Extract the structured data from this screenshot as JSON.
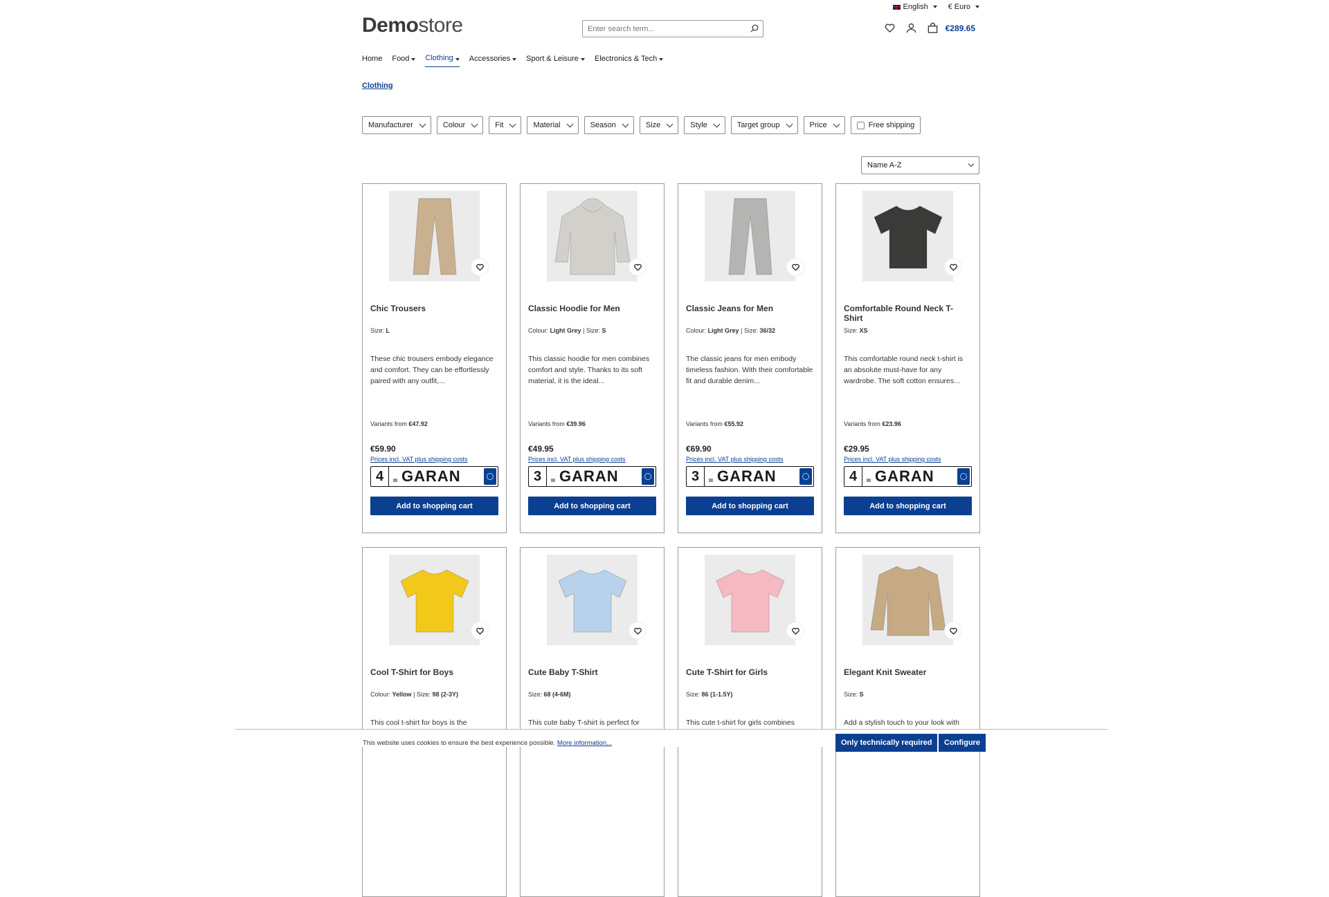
{
  "topbar": {
    "language": "English",
    "currency": "€ Euro"
  },
  "header": {
    "logo_bold": "Demo",
    "logo_light": "store",
    "search_placeholder": "Enter search term...",
    "cart_total": "€289.65"
  },
  "nav": [
    {
      "label": "Home",
      "dropdown": false
    },
    {
      "label": "Food",
      "dropdown": true
    },
    {
      "label": "Clothing",
      "dropdown": true,
      "active": true
    },
    {
      "label": "Accessories",
      "dropdown": true
    },
    {
      "label": "Sport & Leisure",
      "dropdown": true
    },
    {
      "label": "Electronics & Tech",
      "dropdown": true
    }
  ],
  "breadcrumb": "Clothing",
  "filters": [
    "Manufacturer",
    "Colour",
    "Fit",
    "Material",
    "Season",
    "Size",
    "Style",
    "Target group",
    "Price"
  ],
  "free_shipping": "Free shipping",
  "sort": "Name A-Z",
  "common": {
    "vat": "Prices incl. VAT plus shipping costs",
    "add_to_cart": "Add to shopping cart",
    "variants_from": "Variants from",
    "garant_word": "GARAN"
  },
  "products": [
    {
      "name": "Chic Trousers",
      "props": [
        {
          "k": "Size:",
          "v": "L"
        }
      ],
      "desc": "These chic trousers embody elegance and comfort. They can be effortlessly paired with any outfit,...",
      "variants": "€47.92",
      "price": "€59.90",
      "garant": "4",
      "garment": "trousers",
      "color": "#c9b08e"
    },
    {
      "name": "Classic Hoodie for Men",
      "props": [
        {
          "k": "Colour:",
          "v": "Light Grey"
        },
        {
          "k": "Size:",
          "v": "S"
        }
      ],
      "desc": "This classic hoodie for men combines comfort and style. Thanks to its soft material, it is the ideal...",
      "variants": "€39.96",
      "price": "€49.95",
      "garant": "3",
      "garment": "hoodie",
      "color": "#d2d0cb"
    },
    {
      "name": "Classic Jeans for Men",
      "props": [
        {
          "k": "Colour:",
          "v": "Light Grey"
        },
        {
          "k": "Size:",
          "v": "36/32"
        }
      ],
      "desc": "The classic jeans for men embody timeless fashion. With their comfortable fit and durable denim...",
      "variants": "€55.92",
      "price": "€69.90",
      "garant": "3",
      "garment": "trousers",
      "color": "#b4b4b2"
    },
    {
      "name": "Comfortable Round Neck T-Shirt",
      "props": [
        {
          "k": "Size:",
          "v": "XS"
        }
      ],
      "desc": "This comfortable round neck t-shirt is an absolute must-have for any wardrobe. The soft cotton ensures...",
      "variants": "€23.96",
      "price": "€29.95",
      "garant": "4",
      "garment": "tshirt",
      "color": "#3a3b38"
    },
    {
      "name": "Cool T-Shirt for Boys",
      "props": [
        {
          "k": "Colour:",
          "v": "Yellow"
        },
        {
          "k": "Size:",
          "v": "98 (2-3Y)"
        }
      ],
      "desc": "This cool t-shirt for boys is the",
      "garment": "tshirt",
      "color": "#f2c81a"
    },
    {
      "name": "Cute Baby T-Shirt",
      "props": [
        {
          "k": "Size:",
          "v": "68 (4-6M)"
        }
      ],
      "desc": "This cute baby T-shirt is perfect for",
      "garment": "tshirt",
      "color": "#b7d2ea"
    },
    {
      "name": "Cute T-Shirt for Girls",
      "props": [
        {
          "k": "Size:",
          "v": "86 (1-1.5Y)"
        }
      ],
      "desc": "This cute t-shirt for girls combines",
      "garment": "tshirt",
      "color": "#f4b9c1"
    },
    {
      "name": "Elegant Knit Sweater",
      "props": [
        {
          "k": "Size:",
          "v": "S"
        }
      ],
      "desc": "Add a stylish touch to your look with",
      "garment": "sweater",
      "color": "#c6aa85"
    }
  ],
  "cookie": {
    "text": "This website uses cookies to ensure the best experience possible.",
    "more": "More information...",
    "btn_required": "Only technically required",
    "btn_configure": "Configure"
  }
}
